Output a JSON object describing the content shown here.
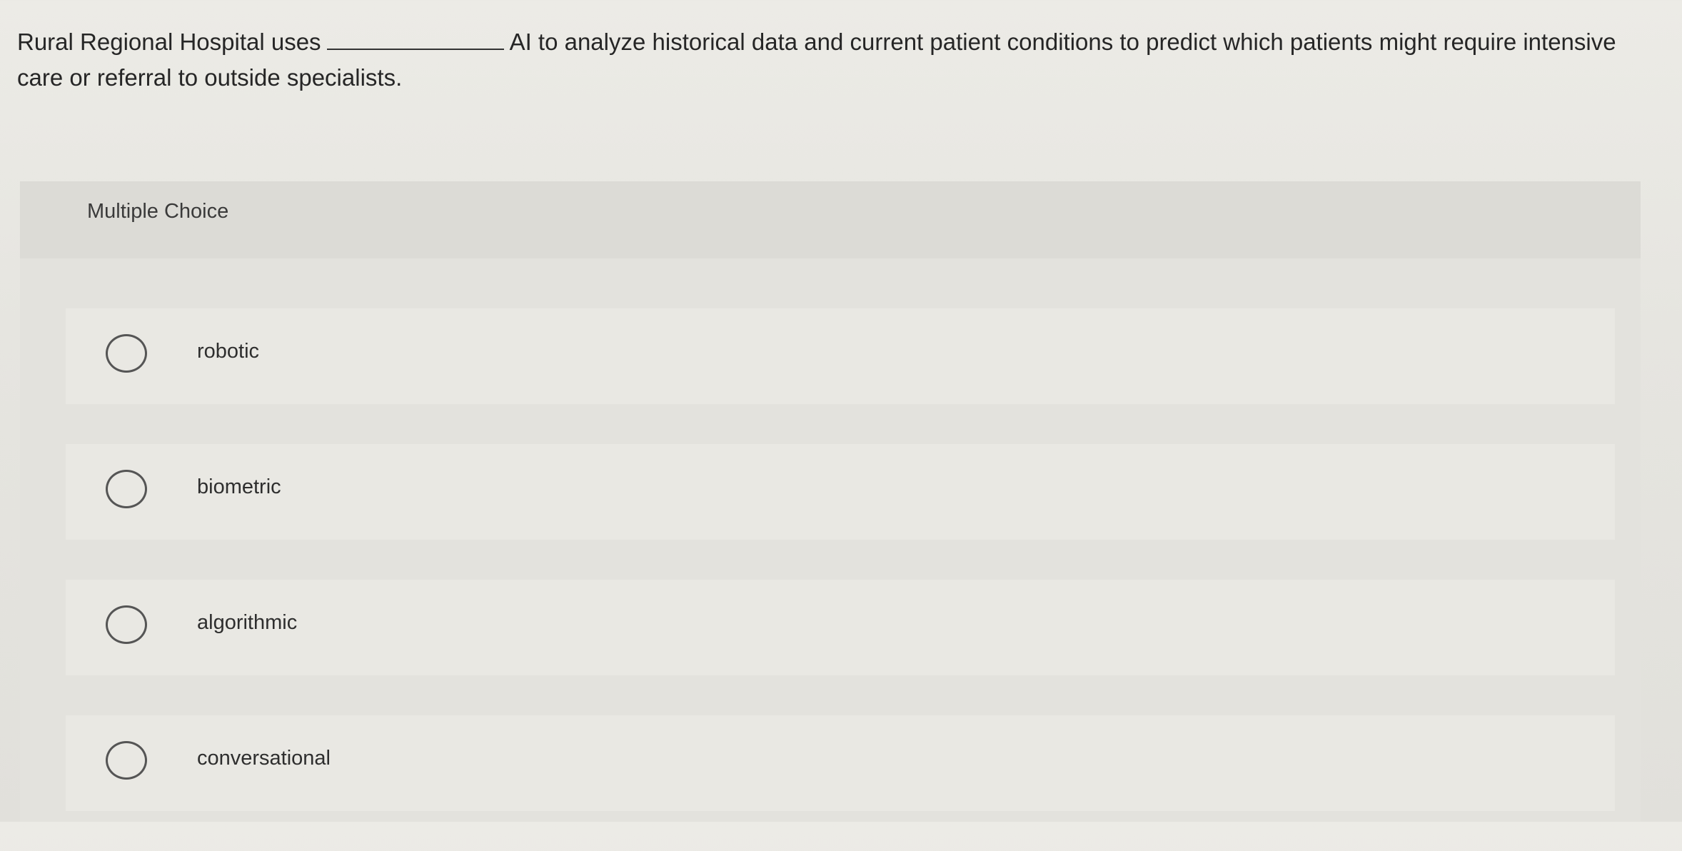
{
  "question": {
    "before_blank": "Rural Regional Hospital uses",
    "after_blank": "AI to analyze historical data and current patient conditions to predict which patients might require intensive care or referral to outside specialists."
  },
  "mc": {
    "title": "Multiple Choice",
    "choices": [
      {
        "label": "robotic",
        "selected": false
      },
      {
        "label": "biometric",
        "selected": false
      },
      {
        "label": "algorithmic",
        "selected": false
      },
      {
        "label": "conversational",
        "selected": false
      }
    ]
  }
}
